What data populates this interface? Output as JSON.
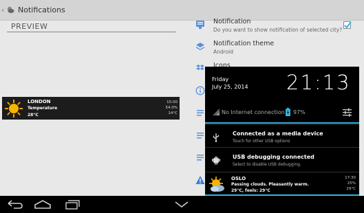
{
  "action_bar": {
    "up_glyph": "‹",
    "app_icon": "weather-cloud-icon",
    "title": "Notifications"
  },
  "preview": {
    "title": "PREVIEW",
    "widget": {
      "icon": "sun-icon",
      "city": "LONDON",
      "condition": "Temperature",
      "temperature": "28°C",
      "right": [
        "15:00",
        "54.0%",
        "14°C"
      ]
    }
  },
  "settings": [
    {
      "icon": "notification-icon",
      "title": "Notification",
      "subtitle": "Do you want to show notification of selected city?",
      "checked": true
    },
    {
      "icon": "layers-icon",
      "title": "Notification theme",
      "subtitle": "Android"
    },
    {
      "icon": "dropbox-icon",
      "title": "Icons"
    }
  ],
  "shade": {
    "day": "Friday",
    "date": "July 25, 2014",
    "time": "21:13",
    "network": "No Internet connection",
    "battery": "97%",
    "notifications": [
      {
        "icon": "usb-icon",
        "title": "Connected as a media device",
        "subtitle": "Touch for other USB options"
      },
      {
        "icon": "android-debug-icon",
        "title": "USB debugging connected",
        "subtitle": "Select to disable USB debugging."
      }
    ],
    "weather": {
      "icon": "sun-cloud-icon",
      "city": "OSLO",
      "condition": "Passing clouds. Pleasantly warm.",
      "feels": "29°C, feels: 29°C",
      "right": [
        "17:30",
        "25%",
        "29°C"
      ]
    }
  },
  "colors": {
    "accent": "#33b5e5",
    "checkbox": "#33b5e5",
    "warning": "#3b7fd1",
    "icon": "#5b8fd9"
  }
}
